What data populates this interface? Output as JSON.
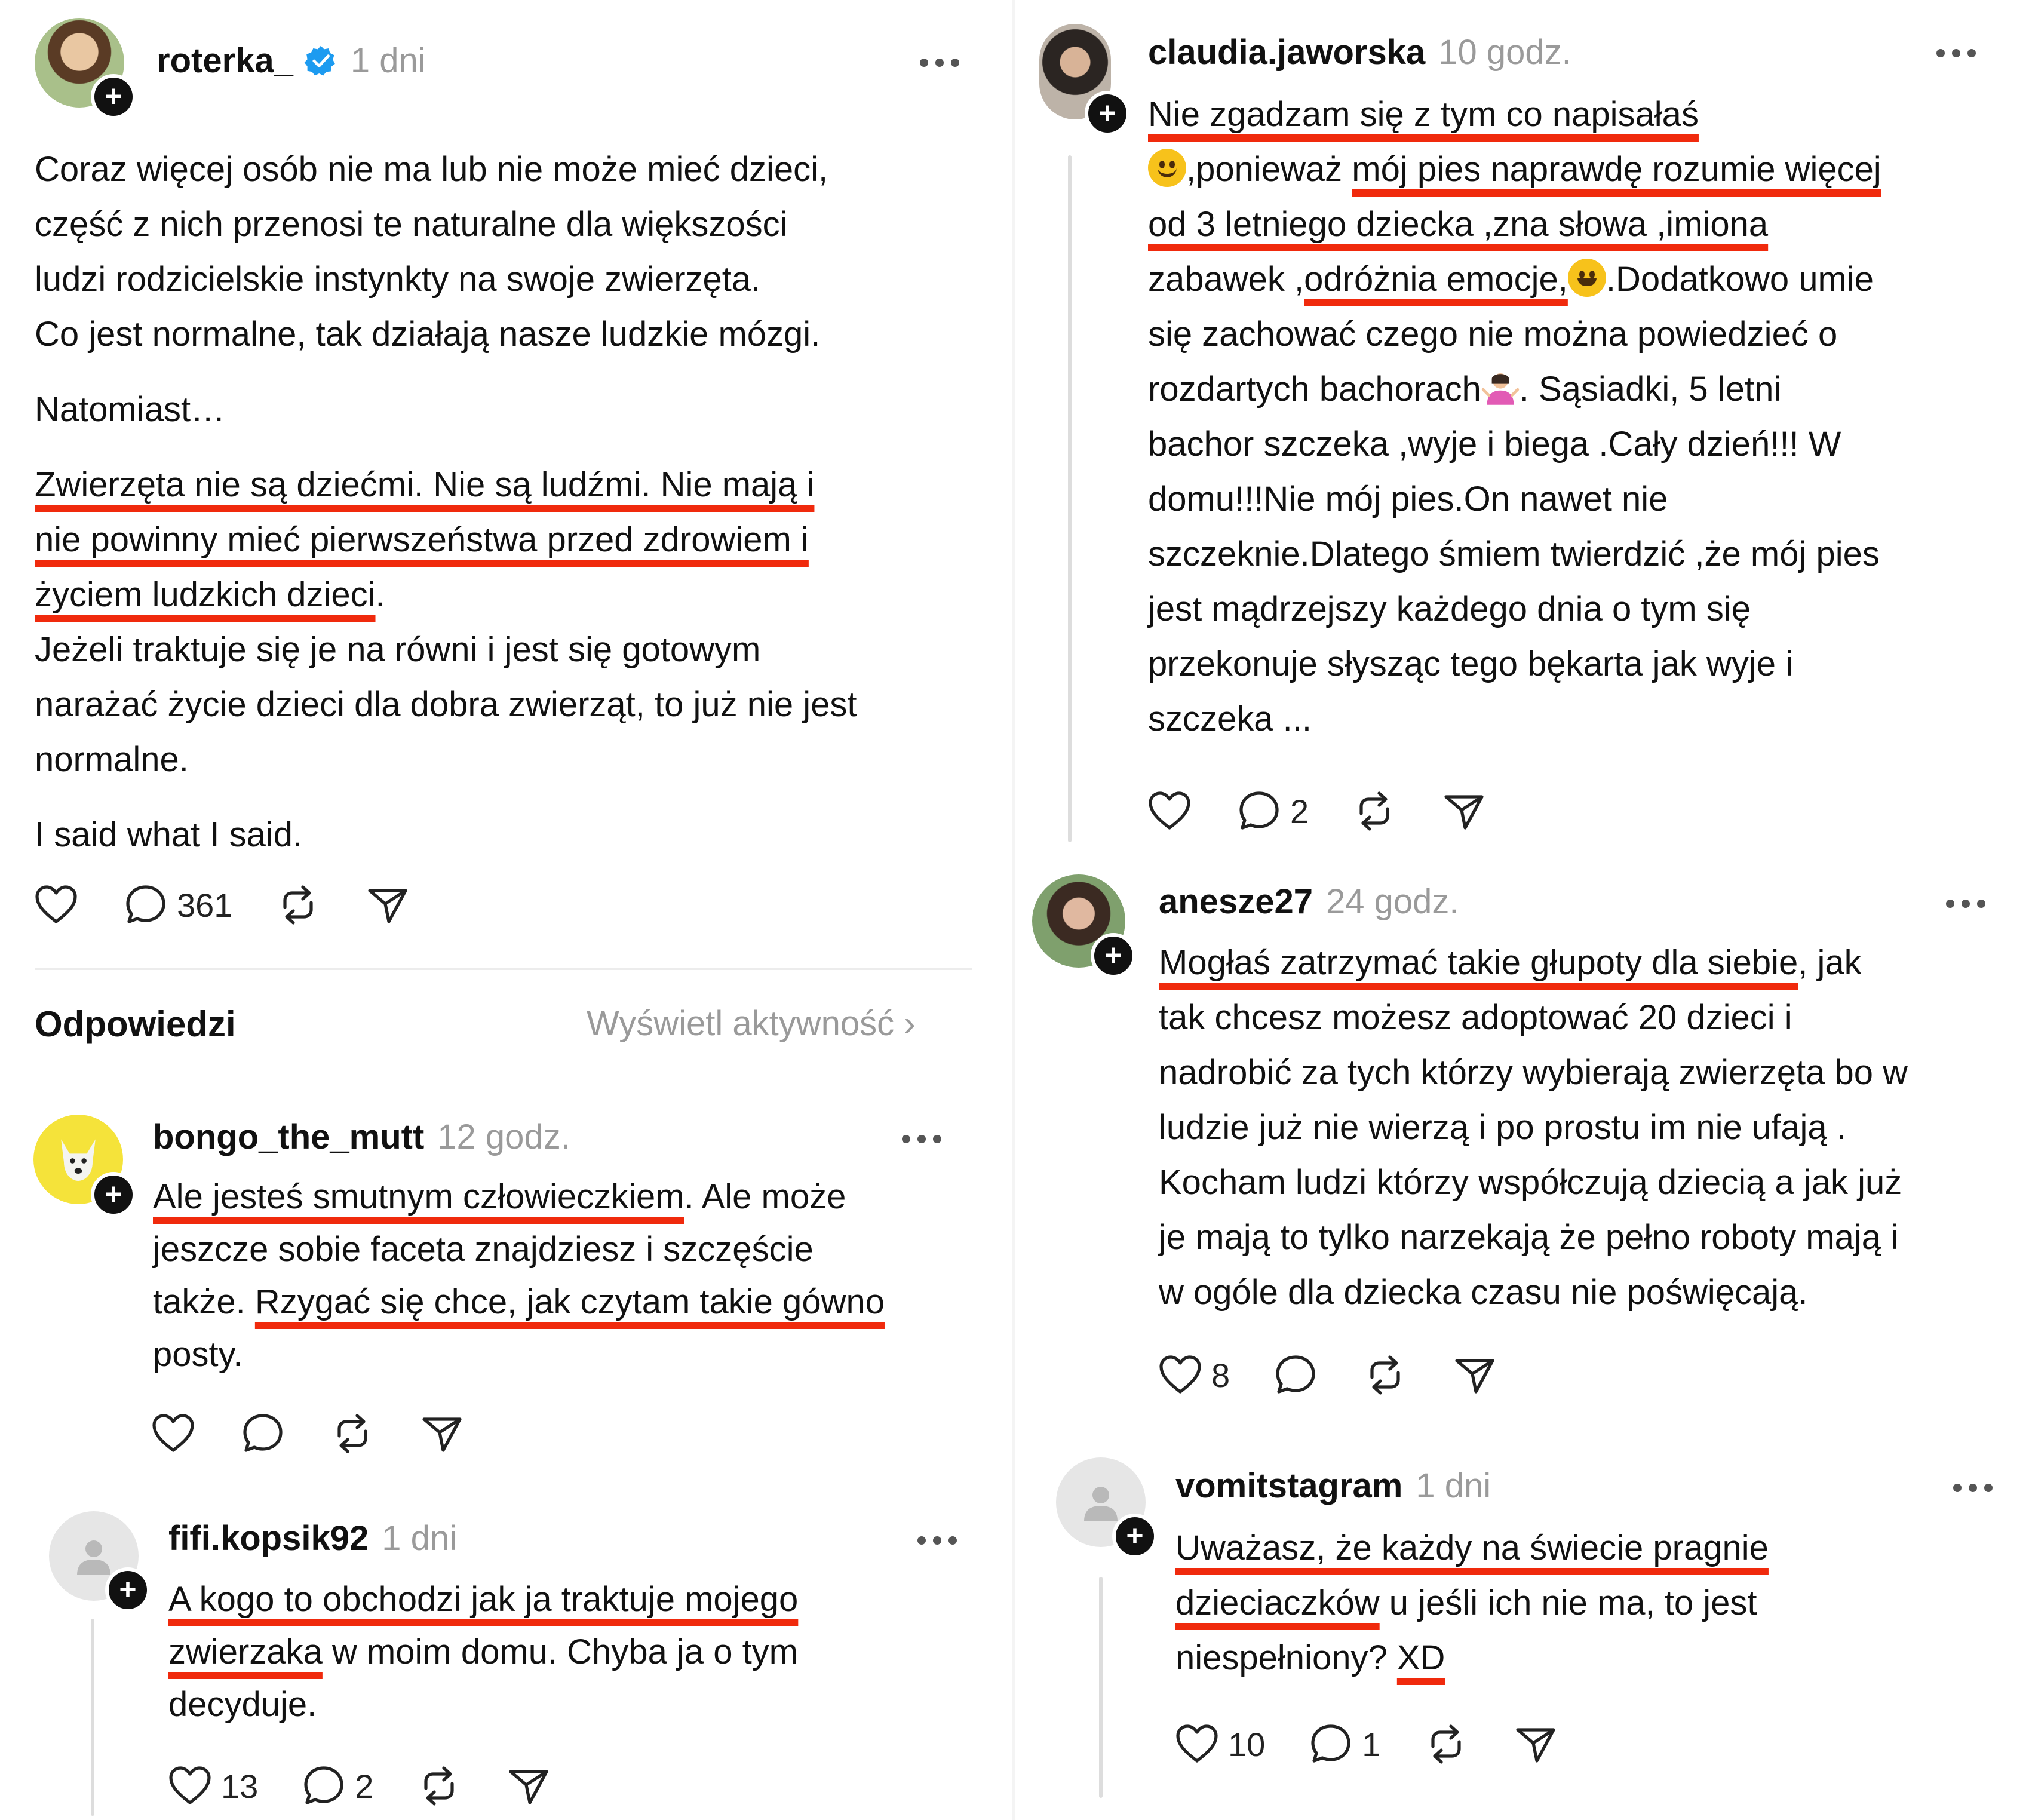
{
  "main_post": {
    "username": "roterka_",
    "verified": true,
    "time": "1 dni",
    "p1": [
      "Coraz więcej osób nie ma lub nie może mieć dzieci,",
      "część z nich przenosi te naturalne dla większości",
      "ludzi rodzicielskie instynkty na swoje zwierzęta.",
      "Co jest normalne, tak działają nasze ludzkie mózgi."
    ],
    "p2": "Natomiast…",
    "p3": [
      "Zwierzęta nie są dziećmi. Nie są ludźmi. Nie mają i",
      "nie powinny mieć pierwszeństwa przed zdrowiem i",
      "życiem ludzkich dzieci"
    ],
    "p3_end": ".",
    "p4": [
      "Jeżeli traktuje się je na równi i jest się gotowym",
      "narażać życie dzieci dla dobra zwierząt, to już nie jest",
      "normalne."
    ],
    "p5": "I said what I said.",
    "replies_count": "361"
  },
  "replies_section": {
    "title": "Odpowiedzi",
    "activity_link": "Wyświetl aktywność ›"
  },
  "bongo": {
    "username": "bongo_the_mutt",
    "time": "12 godz.",
    "l1_u": "Ale jesteś smutnym człowieczkiem",
    "l1_rest": ". Ale może",
    "l2": "jeszcze sobie faceta znajdziesz i szczęście",
    "l3_pre": "także. ",
    "l3_u": "Rzygać się chce, jak czytam takie gówno",
    "l4": "posty."
  },
  "fifi": {
    "username": "fifi.kopsik92",
    "time": "1 dni",
    "l1_u": "A kogo to obchodzi jak ja traktuje mojego",
    "l2_u": "zwierzaka",
    "l2_rest": " w moim domu. Chyba ja o tym",
    "l3": "decyduje.",
    "likes": "13",
    "comments": "2"
  },
  "claudia": {
    "username": "claudia.jaworska",
    "time": "10 godz.",
    "l1_u": "Nie zgadzam się z tym co napisałaś",
    "l2_pre": ",ponieważ ",
    "l2_u": "mój pies naprawdę rozumie więcej",
    "l3_u": "od 3 letniego dziecka ,zna słowa ,imiona",
    "l4_pre": "zabawek ,",
    "l4_u": "odróżnia emocje,",
    "l4_rest": ".Dodatkowo umie",
    "l5": "się zachować czego nie można powiedzieć o",
    "l6_pre": "rozdartych bachorach",
    "l6_rest": ". Sąsiadki, 5 letni",
    "l7": "bachor szczeka ,wyje i biega .Cały dzień!!! W",
    "l8": "domu!!!Nie mój pies.On nawet nie",
    "l9": "szczeknie.Dlatego śmiem twierdzić ,że mój pies",
    "l10": "jest mądrzejszy każdego dnia o tym się",
    "l11": "przekonuje słysząc tego bękarta jak wyje i",
    "l12": "szczeka ...",
    "comments": "2"
  },
  "anesze": {
    "username": "anesze27",
    "time": "24 godz.",
    "l1_u": "Mogłaś zatrzymać takie głupoty dla siebie",
    "l1_rest": ", jak",
    "l2": "tak chcesz możesz adoptować 20 dzieci i",
    "l3": "nadrobić za tych którzy wybierają zwierzęta bo w",
    "l4": "ludzie już nie wierzą i po prostu im nie ufają .",
    "l5": "Kocham ludzi którzy współczują dziecią a jak już",
    "l6": "je mają to tylko narzekają że pełno roboty mają i",
    "l7": "w ogóle dla dziecka czasu nie poświęcają.",
    "likes": "8"
  },
  "vomit": {
    "username": "vomitstagram",
    "time": "1 dni",
    "l1_u": "Uważasz, że każdy na świecie pragnie",
    "l2_u": "dzieciaczków",
    "l2_rest": " u jeśli ich nie ma, to jest",
    "l3_pre": "niespełniony? ",
    "l3_u": "XD",
    "likes": "10",
    "comments": "1"
  },
  "colors": {
    "underline": "#f02a0d",
    "verified": "#1d9bf0",
    "muted": "#9a9a9a"
  }
}
